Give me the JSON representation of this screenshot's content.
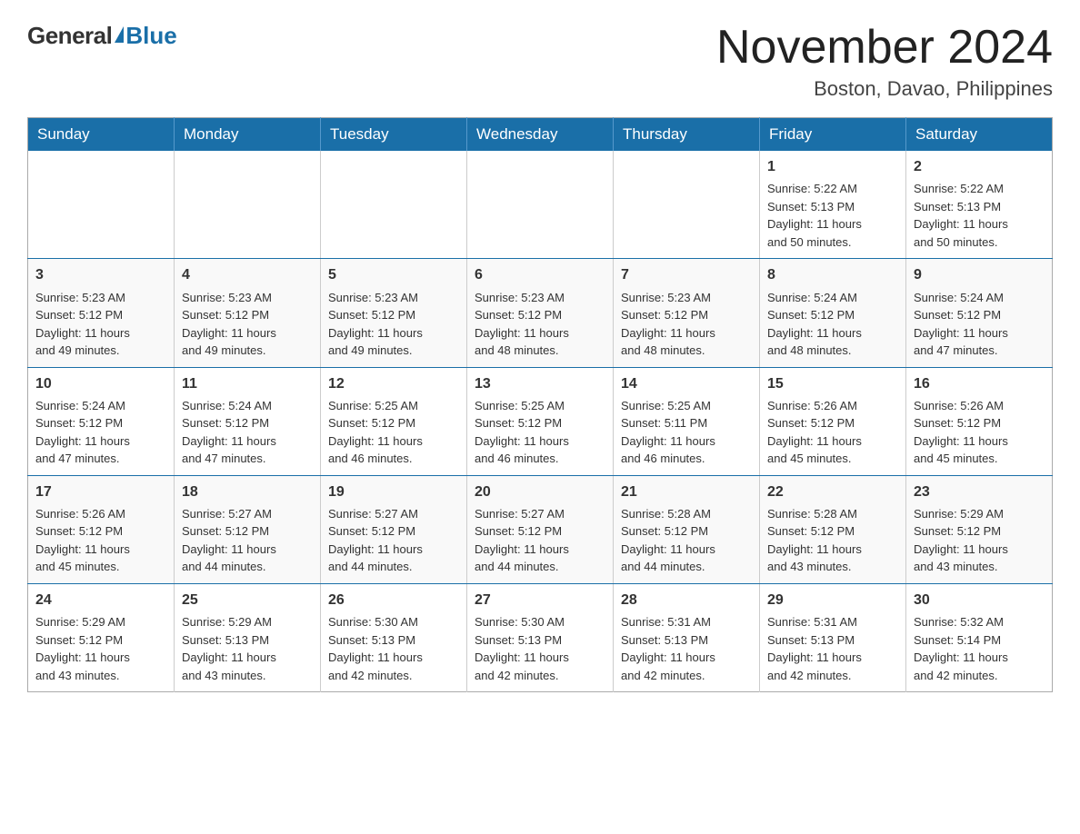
{
  "logo": {
    "general": "General",
    "blue": "Blue"
  },
  "header": {
    "month": "November 2024",
    "location": "Boston, Davao, Philippines"
  },
  "days_of_week": [
    "Sunday",
    "Monday",
    "Tuesday",
    "Wednesday",
    "Thursday",
    "Friday",
    "Saturday"
  ],
  "weeks": [
    [
      {
        "day": "",
        "info": ""
      },
      {
        "day": "",
        "info": ""
      },
      {
        "day": "",
        "info": ""
      },
      {
        "day": "",
        "info": ""
      },
      {
        "day": "",
        "info": ""
      },
      {
        "day": "1",
        "info": "Sunrise: 5:22 AM\nSunset: 5:13 PM\nDaylight: 11 hours\nand 50 minutes."
      },
      {
        "day": "2",
        "info": "Sunrise: 5:22 AM\nSunset: 5:13 PM\nDaylight: 11 hours\nand 50 minutes."
      }
    ],
    [
      {
        "day": "3",
        "info": "Sunrise: 5:23 AM\nSunset: 5:12 PM\nDaylight: 11 hours\nand 49 minutes."
      },
      {
        "day": "4",
        "info": "Sunrise: 5:23 AM\nSunset: 5:12 PM\nDaylight: 11 hours\nand 49 minutes."
      },
      {
        "day": "5",
        "info": "Sunrise: 5:23 AM\nSunset: 5:12 PM\nDaylight: 11 hours\nand 49 minutes."
      },
      {
        "day": "6",
        "info": "Sunrise: 5:23 AM\nSunset: 5:12 PM\nDaylight: 11 hours\nand 48 minutes."
      },
      {
        "day": "7",
        "info": "Sunrise: 5:23 AM\nSunset: 5:12 PM\nDaylight: 11 hours\nand 48 minutes."
      },
      {
        "day": "8",
        "info": "Sunrise: 5:24 AM\nSunset: 5:12 PM\nDaylight: 11 hours\nand 48 minutes."
      },
      {
        "day": "9",
        "info": "Sunrise: 5:24 AM\nSunset: 5:12 PM\nDaylight: 11 hours\nand 47 minutes."
      }
    ],
    [
      {
        "day": "10",
        "info": "Sunrise: 5:24 AM\nSunset: 5:12 PM\nDaylight: 11 hours\nand 47 minutes."
      },
      {
        "day": "11",
        "info": "Sunrise: 5:24 AM\nSunset: 5:12 PM\nDaylight: 11 hours\nand 47 minutes."
      },
      {
        "day": "12",
        "info": "Sunrise: 5:25 AM\nSunset: 5:12 PM\nDaylight: 11 hours\nand 46 minutes."
      },
      {
        "day": "13",
        "info": "Sunrise: 5:25 AM\nSunset: 5:12 PM\nDaylight: 11 hours\nand 46 minutes."
      },
      {
        "day": "14",
        "info": "Sunrise: 5:25 AM\nSunset: 5:11 PM\nDaylight: 11 hours\nand 46 minutes."
      },
      {
        "day": "15",
        "info": "Sunrise: 5:26 AM\nSunset: 5:12 PM\nDaylight: 11 hours\nand 45 minutes."
      },
      {
        "day": "16",
        "info": "Sunrise: 5:26 AM\nSunset: 5:12 PM\nDaylight: 11 hours\nand 45 minutes."
      }
    ],
    [
      {
        "day": "17",
        "info": "Sunrise: 5:26 AM\nSunset: 5:12 PM\nDaylight: 11 hours\nand 45 minutes."
      },
      {
        "day": "18",
        "info": "Sunrise: 5:27 AM\nSunset: 5:12 PM\nDaylight: 11 hours\nand 44 minutes."
      },
      {
        "day": "19",
        "info": "Sunrise: 5:27 AM\nSunset: 5:12 PM\nDaylight: 11 hours\nand 44 minutes."
      },
      {
        "day": "20",
        "info": "Sunrise: 5:27 AM\nSunset: 5:12 PM\nDaylight: 11 hours\nand 44 minutes."
      },
      {
        "day": "21",
        "info": "Sunrise: 5:28 AM\nSunset: 5:12 PM\nDaylight: 11 hours\nand 44 minutes."
      },
      {
        "day": "22",
        "info": "Sunrise: 5:28 AM\nSunset: 5:12 PM\nDaylight: 11 hours\nand 43 minutes."
      },
      {
        "day": "23",
        "info": "Sunrise: 5:29 AM\nSunset: 5:12 PM\nDaylight: 11 hours\nand 43 minutes."
      }
    ],
    [
      {
        "day": "24",
        "info": "Sunrise: 5:29 AM\nSunset: 5:12 PM\nDaylight: 11 hours\nand 43 minutes."
      },
      {
        "day": "25",
        "info": "Sunrise: 5:29 AM\nSunset: 5:13 PM\nDaylight: 11 hours\nand 43 minutes."
      },
      {
        "day": "26",
        "info": "Sunrise: 5:30 AM\nSunset: 5:13 PM\nDaylight: 11 hours\nand 42 minutes."
      },
      {
        "day": "27",
        "info": "Sunrise: 5:30 AM\nSunset: 5:13 PM\nDaylight: 11 hours\nand 42 minutes."
      },
      {
        "day": "28",
        "info": "Sunrise: 5:31 AM\nSunset: 5:13 PM\nDaylight: 11 hours\nand 42 minutes."
      },
      {
        "day": "29",
        "info": "Sunrise: 5:31 AM\nSunset: 5:13 PM\nDaylight: 11 hours\nand 42 minutes."
      },
      {
        "day": "30",
        "info": "Sunrise: 5:32 AM\nSunset: 5:14 PM\nDaylight: 11 hours\nand 42 minutes."
      }
    ]
  ]
}
